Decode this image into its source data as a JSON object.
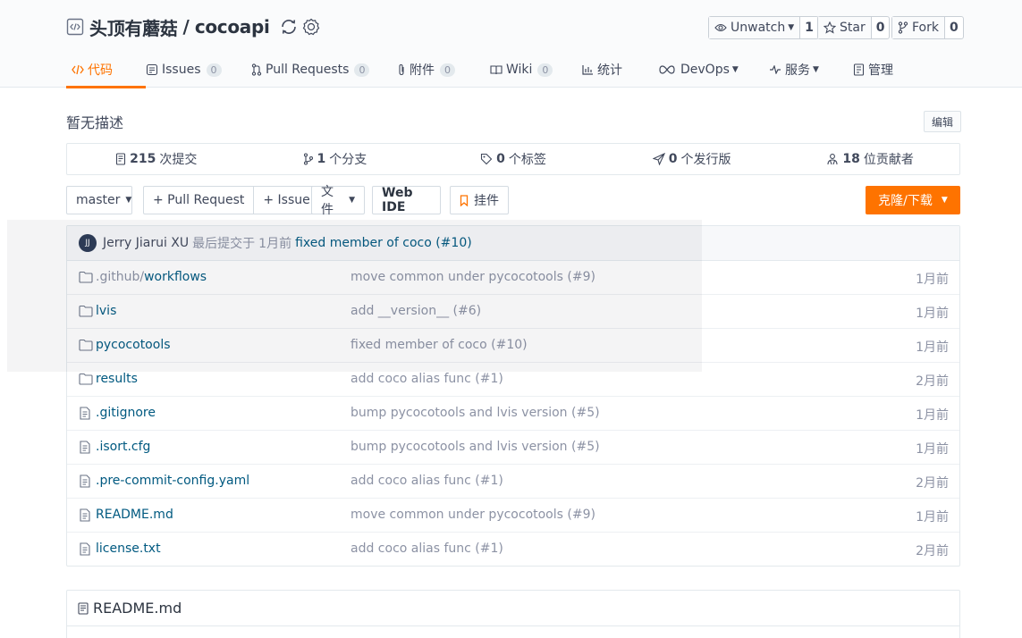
{
  "repo": {
    "owner": "头顶有蘑菇",
    "separator": "/",
    "name": "cocoapi"
  },
  "actions": {
    "watch_label": "Unwatch",
    "watch_count": "1",
    "star_label": "Star",
    "star_count": "0",
    "fork_label": "Fork",
    "fork_count": "0"
  },
  "tabs": [
    {
      "label": "代码",
      "badge": null,
      "icon": "code-icon"
    },
    {
      "label": "Issues",
      "badge": "0",
      "icon": "issues-icon"
    },
    {
      "label": "Pull Requests",
      "badge": "0",
      "icon": "pull-request-icon"
    },
    {
      "label": "附件",
      "badge": "0",
      "icon": "attachment-icon"
    },
    {
      "label": "Wiki",
      "badge": "0",
      "icon": "wiki-icon"
    },
    {
      "label": "统计",
      "badge": null,
      "icon": "stats-icon"
    },
    {
      "label": "DevOps",
      "badge": null,
      "icon": "devops-icon"
    },
    {
      "label": "服务",
      "badge": null,
      "icon": "service-icon"
    },
    {
      "label": "管理",
      "badge": null,
      "icon": "manage-icon"
    }
  ],
  "description": "暂无描述",
  "edit_label": "编辑",
  "stats": [
    {
      "count": "215",
      "label": "次提交",
      "icon": "commit-icon"
    },
    {
      "count": "1",
      "label": "个分支",
      "icon": "branch-icon"
    },
    {
      "count": "0",
      "label": "个标签",
      "icon": "tag-icon"
    },
    {
      "count": "0",
      "label": "个发行版",
      "icon": "release-icon"
    },
    {
      "count": "18",
      "label": "位贡献者",
      "icon": "contributors-icon"
    }
  ],
  "toolbar": {
    "branch": "master",
    "pull_request": "+ Pull Request",
    "issue": "+ Issue",
    "file": "文件",
    "web_ide": "Web IDE",
    "widget": "挂件",
    "clone": "克隆/下载"
  },
  "last_commit": {
    "avatar_initials": "JJ",
    "author": "Jerry Jiarui XU",
    "prefix": "最后提交于",
    "time": "1月前",
    "message": "fixed member of coco (#10)"
  },
  "files": [
    {
      "type": "folder",
      "prefix": ".github/",
      "name": "workflows",
      "message": "move common under pycocotools (#9)",
      "time": "1月前"
    },
    {
      "type": "folder",
      "prefix": "",
      "name": "lvis",
      "message": "add __version__ (#6)",
      "time": "1月前"
    },
    {
      "type": "folder",
      "prefix": "",
      "name": "pycocotools",
      "message": "fixed member of coco (#10)",
      "time": "1月前"
    },
    {
      "type": "folder",
      "prefix": "",
      "name": "results",
      "message": "add coco alias func (#1)",
      "time": "2月前"
    },
    {
      "type": "file",
      "prefix": "",
      "name": ".gitignore",
      "message": "bump pycocotools and lvis version (#5)",
      "time": "1月前"
    },
    {
      "type": "file",
      "prefix": "",
      "name": ".isort.cfg",
      "message": "bump pycocotools and lvis version (#5)",
      "time": "1月前"
    },
    {
      "type": "file",
      "prefix": "",
      "name": ".pre-commit-config.yaml",
      "message": "add coco alias func (#1)",
      "time": "2月前"
    },
    {
      "type": "file",
      "prefix": "",
      "name": "README.md",
      "message": "move common under pycocotools (#9)",
      "time": "1月前"
    },
    {
      "type": "file",
      "prefix": "",
      "name": "license.txt",
      "message": "add coco alias func (#1)",
      "time": "2月前"
    }
  ],
  "readme": {
    "title": "README.md"
  },
  "colors": {
    "accent": "#fe7300",
    "link": "#005980",
    "muted": "#8c92a4"
  }
}
